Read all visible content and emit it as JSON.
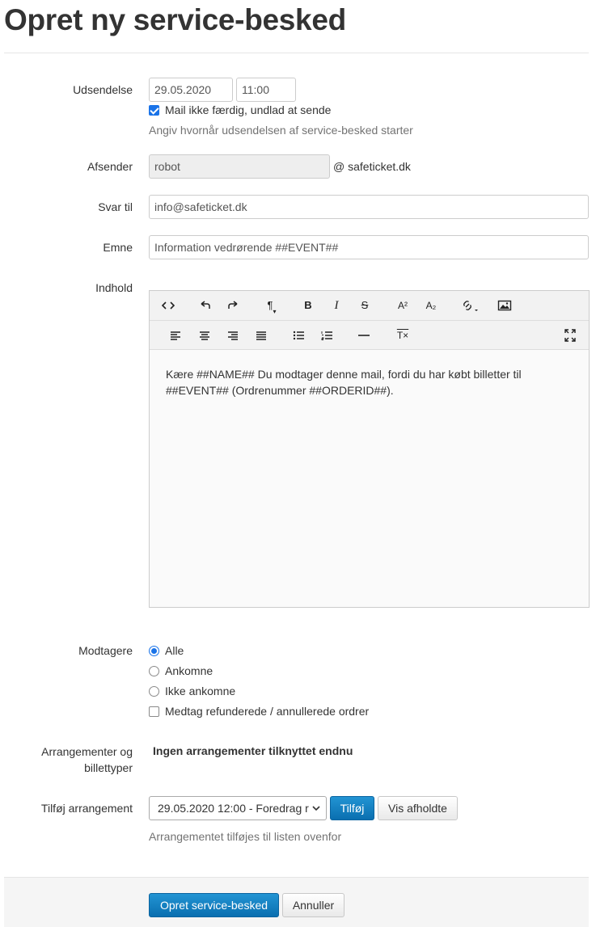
{
  "page": {
    "title": "Opret ny service-besked"
  },
  "udsendelse": {
    "label": "Udsendelse",
    "date": "29.05.2020",
    "time": "11:00",
    "checkbox_label": "Mail ikke færdig, undlad at sende",
    "checkbox_checked": true,
    "help": "Angiv hvornår udsendelsen af service-besked starter"
  },
  "afsender": {
    "label": "Afsender",
    "value": "robot",
    "domain": "@ safeticket.dk"
  },
  "svar_til": {
    "label": "Svar til",
    "value": "info@safeticket.dk"
  },
  "emne": {
    "label": "Emne",
    "value": "Information vedrørende ##EVENT##"
  },
  "indhold": {
    "label": "Indhold",
    "toolbar": {
      "bold": "B",
      "italic": "I",
      "strike": "S",
      "superscript": "A²",
      "subscript": "A₂",
      "paragraph": "¶",
      "clear_format": "T×"
    },
    "content_line1": "Kære ##NAME## Du modtager denne mail, fordi du har købt billetter til",
    "content_line2": "##EVENT## (Ordrenummer ##ORDERID##)."
  },
  "modtagere": {
    "label": "Modtagere",
    "options": [
      {
        "label": "Alle",
        "checked": true
      },
      {
        "label": "Ankomne",
        "checked": false
      },
      {
        "label": "Ikke ankomne",
        "checked": false
      }
    ],
    "include_refunded_label": "Medtag refunderede / annullerede ordrer"
  },
  "arrangementer": {
    "label_line1": "Arrangementer og",
    "label_line2": "billettyper",
    "empty_text": "Ingen arrangementer tilknyttet endnu"
  },
  "tilfoej": {
    "label": "Tilføj arrangement",
    "selected": "29.05.2020 12:00 - Foredrag r",
    "add_button": "Tilføj",
    "show_held_button": "Vis afholdte",
    "help": "Arrangementet tilføjes til listen ovenfor"
  },
  "footer": {
    "submit": "Opret service-besked",
    "cancel": "Annuller"
  },
  "colors": {
    "primary": "#0a6fb0",
    "accent": "#1a73e8"
  }
}
